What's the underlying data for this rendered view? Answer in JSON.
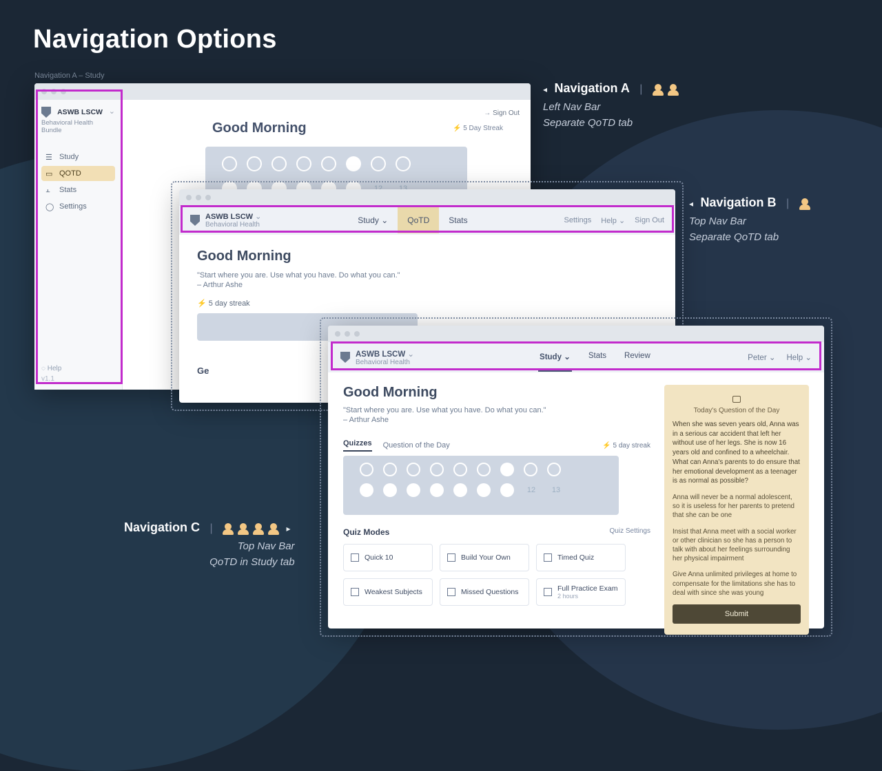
{
  "page_title": "Navigation Options",
  "navA": {
    "caption": "Navigation A – Study",
    "product_title": "ASWB LSCW",
    "product_subtitle": "Behavioral Health Bundle",
    "menu": {
      "study": "Study",
      "qotd": "QOTD",
      "stats": "Stats",
      "settings": "Settings"
    },
    "help": "Help",
    "version": "v1.1",
    "signout": "Sign Out",
    "greeting": "Good Morning",
    "streak": "5 Day Streak"
  },
  "navB": {
    "product_title": "ASWB LSCW",
    "product_subtitle": "Behavioral Health",
    "tabs": {
      "study": "Study",
      "qotd": "QoTD",
      "stats": "Stats"
    },
    "right": {
      "settings": "Settings",
      "help": "Help",
      "signout": "Sign Out"
    },
    "greeting": "Good Morning",
    "quote": "\"Start where you are. Use what you have. Do what you can.\"",
    "author": "– Arthur Ashe",
    "streak": "5 day streak",
    "get_started": "Ge"
  },
  "navC": {
    "product_title": "ASWB LSCW",
    "product_subtitle": "Behavioral Health",
    "tabs": {
      "study": "Study",
      "stats": "Stats",
      "review": "Review"
    },
    "right": {
      "user": "Peter",
      "help": "Help"
    },
    "greeting": "Good Morning",
    "quote": "\"Start where you are. Use what you have. Do what you can.\"",
    "author": "– Arthur Ashe",
    "subtabs": {
      "quizzes": "Quizzes",
      "qotd": "Question of the Day"
    },
    "streak": "5 day streak",
    "dates": {
      "d12": "12",
      "d13": "13"
    },
    "quiz_modes_label": "Quiz Modes",
    "quiz_settings": "Quiz Settings",
    "quizzes": {
      "quick10": "Quick 10",
      "build": "Build Your Own",
      "timed": "Timed Quiz",
      "weakest": "Weakest Subjects",
      "missed": "Missed Questions",
      "practice": "Full Practice Exam",
      "practice_sub": "2 hours"
    },
    "qotd": {
      "header": "Today's Question of the Day",
      "question": "When she was seven years old, Anna was in a serious car accident that left her without use of her legs. She is now 16 years old and confined to a wheelchair. What can Anna's parents to do ensure that her emotional development as a teenager is as normal as possible?",
      "option1": "Anna will never be a normal adolescent, so it is useless for her parents to pretend that she can be one",
      "option2": "Insist that Anna meet with a social worker or other clinician so she has a person to talk with about her feelings surrounding her physical impairment",
      "option3": "Give Anna unlimited privileges at home to compensate for the limitations she has to deal with since she was young",
      "submit": "Submit"
    }
  },
  "annotations": {
    "a_title": "Navigation A",
    "a_line1": "Left Nav Bar",
    "a_line2": "Separate QoTD tab",
    "b_title": "Navigation B",
    "b_line1": "Top Nav Bar",
    "b_line2": "Separate QoTD tab",
    "c_title": "Navigation C",
    "c_line1": "Top Nav Bar",
    "c_line2": "QoTD in Study tab"
  }
}
